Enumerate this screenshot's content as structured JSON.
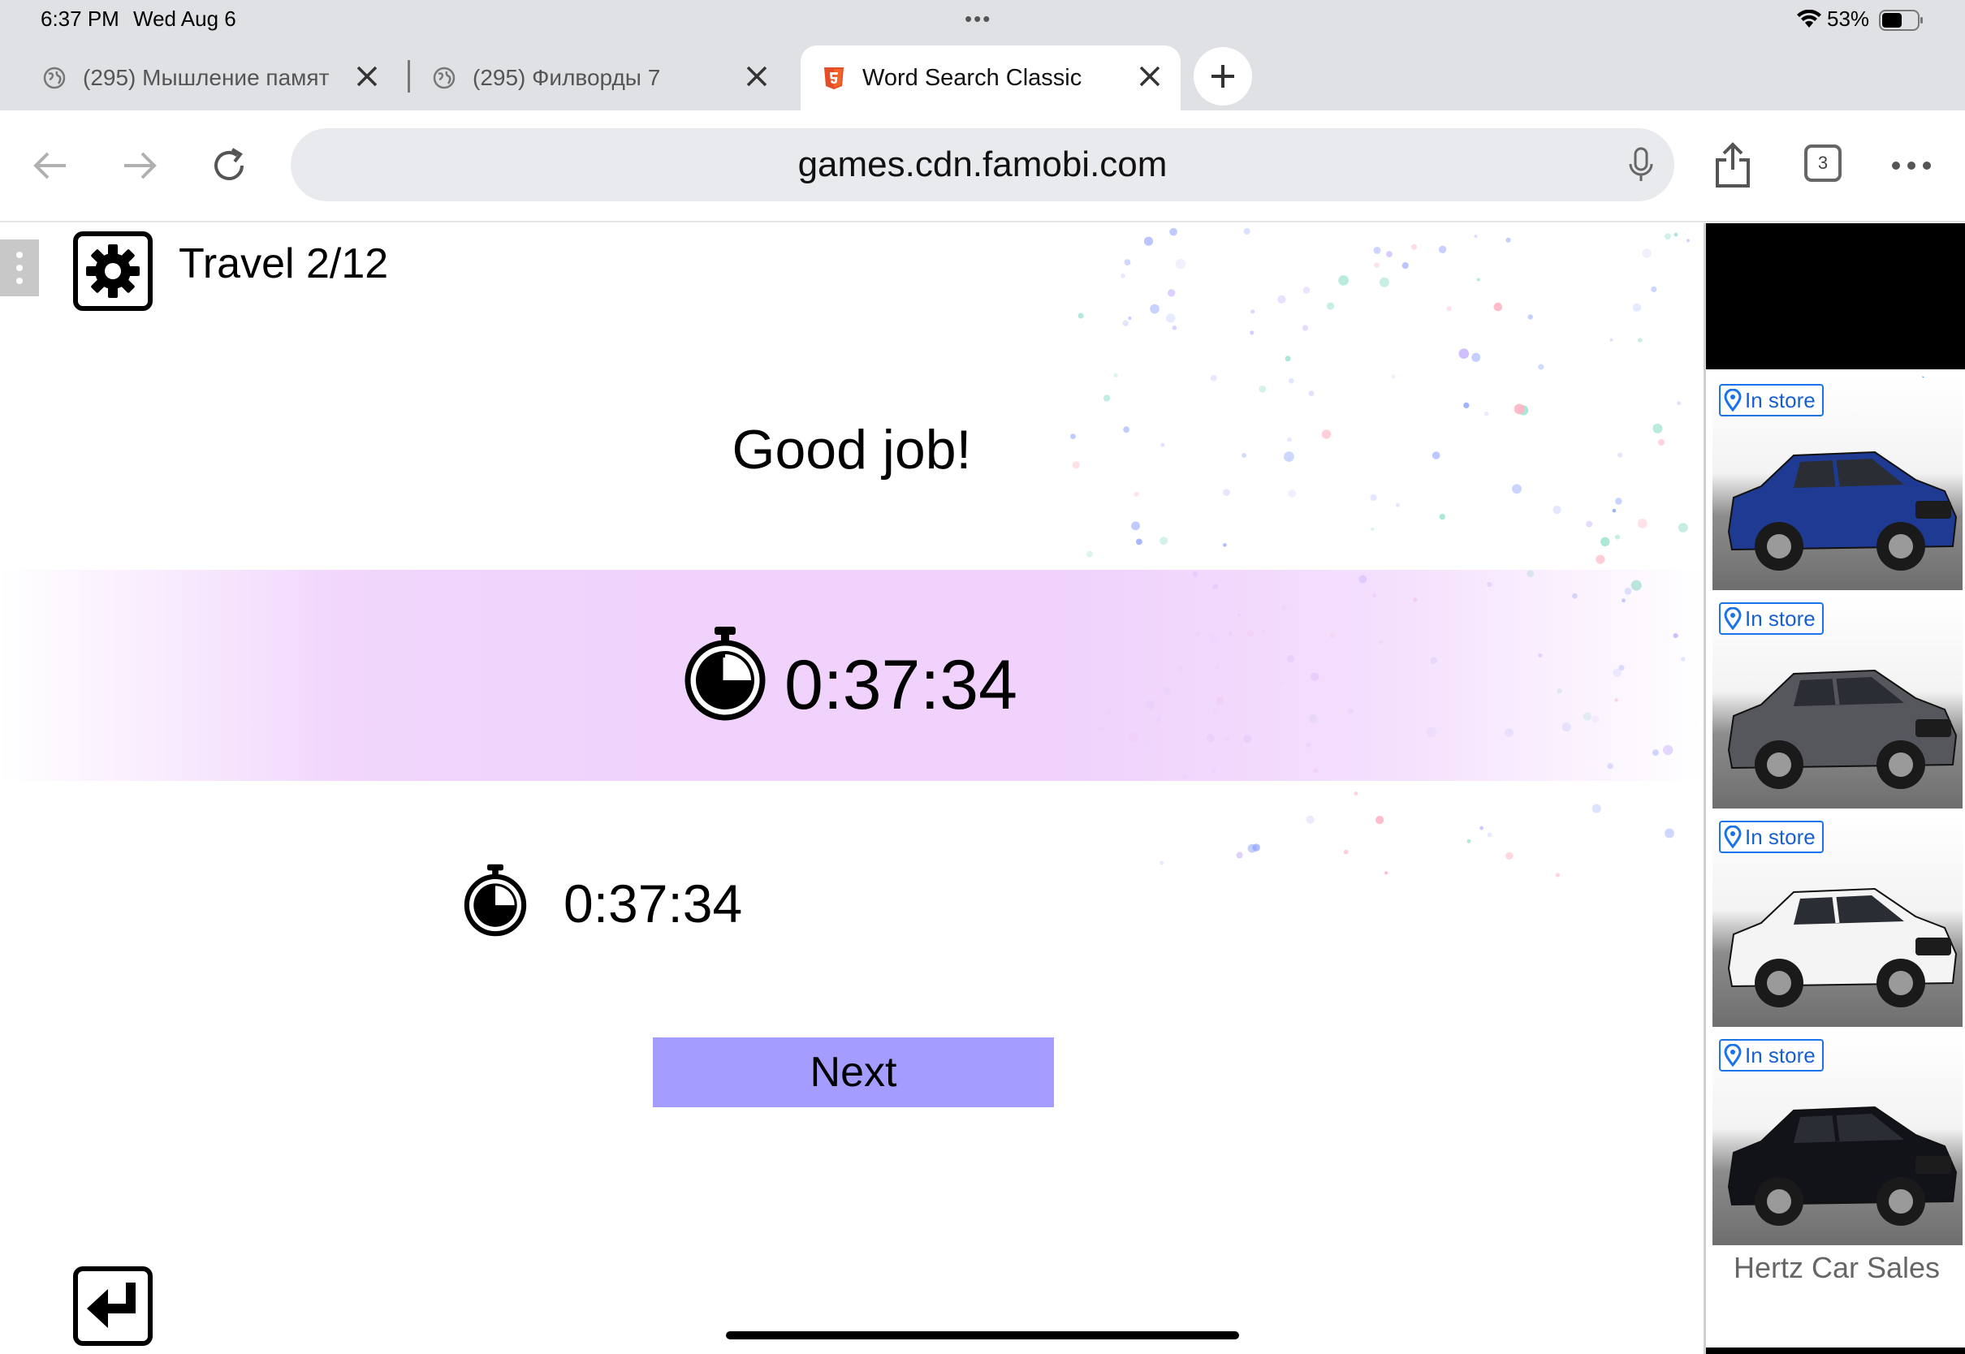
{
  "status_bar": {
    "time": "6:37 PM",
    "date": "Wed Aug 6",
    "battery": "53%"
  },
  "tabs": [
    {
      "title": "(295) Мышление памят",
      "favicon": "globe-icon",
      "active": false
    },
    {
      "title": "(295) Филворды 7",
      "favicon": "globe-icon",
      "active": false
    },
    {
      "title": "Word Search Classic",
      "favicon": "html5-icon",
      "active": true
    }
  ],
  "toolbar": {
    "url": "games.cdn.famobi.com",
    "tab_count": "3"
  },
  "game": {
    "level_label": "Travel 2/12",
    "headline": "Good job!",
    "time_main": "0:37:34",
    "time_best": "0:37:34",
    "next_label": "Next",
    "band_color": "#f0d2fc",
    "button_color": "#a59cff"
  },
  "ad": {
    "badge_label": "In store",
    "cards": [
      {
        "car_color": "#1f3a93",
        "icon": "location-pin-icon"
      },
      {
        "car_color": "#55575c",
        "icon": "location-pin-icon"
      },
      {
        "car_color": "#f4f4f4",
        "icon": "location-pin-icon"
      },
      {
        "car_color": "#121318",
        "icon": "location-pin-icon"
      }
    ],
    "footer": "Hertz Car Sales",
    "accent_color": "#1a73e8"
  }
}
